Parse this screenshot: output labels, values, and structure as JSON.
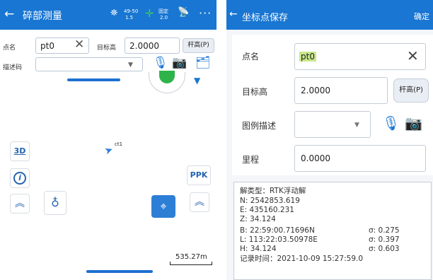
{
  "left": {
    "title": "碎部测量",
    "status": {
      "sat_top": "49-50",
      "sat_bottom": "1.5",
      "fix_top": "固定",
      "fix_bottom": "2.0"
    },
    "form": {
      "point_name_label": "点名",
      "point_name_value": "pt0",
      "target_height_label": "目标高",
      "target_height_value": "2.0000",
      "pole_button": "杆高(P)",
      "desc_label": "描述码"
    },
    "map": {
      "point_label": "ct1",
      "btn_3d": "3D",
      "btn_info": "i",
      "ppk_label": "PPK",
      "scale_text": "535.27m"
    }
  },
  "right": {
    "title": "坐标点保存",
    "confirm": "确定",
    "form": {
      "point_name_label": "点名",
      "point_name_value": "pt0",
      "target_height_label": "目标高",
      "target_height_value": "2.0000",
      "pole_button": "杆高(P)",
      "legend_label": "图例描述",
      "mileage_label": "里程",
      "mileage_value": "0.0000"
    },
    "info": {
      "solution": "解类型：RTK浮动解",
      "n": "N: 2542853.619",
      "e": "E: 435160.231",
      "z": "Z: 34.124",
      "b": "B: 22:59:00.71696N",
      "b_sigma": "σ: 0.275",
      "l": "L: 113:22:03.50978E",
      "l_sigma": "σ: 0.397",
      "h": "H: 34.124",
      "h_sigma": "σ: 0.603",
      "record_time": "记录时间：2021-10-09 15:27:59.0"
    }
  },
  "colors": {
    "primary": "#1976d2",
    "marker_blue": "#2d7fd6",
    "green": "#2eb34a"
  }
}
